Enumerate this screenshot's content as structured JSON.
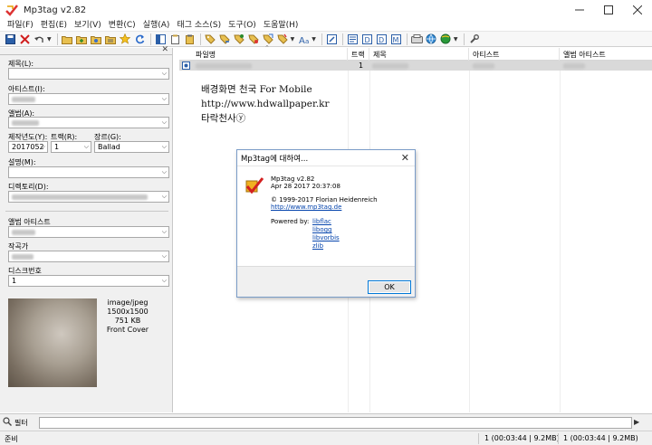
{
  "window": {
    "title": "Mp3tag v2.82"
  },
  "menu": [
    "파일(F)",
    "편집(E)",
    "보기(V)",
    "변환(C)",
    "실행(A)",
    "태그 소스(S)",
    "도구(O)",
    "도움말(H)"
  ],
  "tag_panel": {
    "title_label": "제목(L):",
    "artist_label": "아티스트(I):",
    "album_label": "앨범(A):",
    "year_label": "제작년도(Y):",
    "year_value": "2017052",
    "track_label": "트랙(R):",
    "track_value": "1",
    "genre_label": "장르(G):",
    "genre_value": "Ballad",
    "comment_label": "설명(M):",
    "directory_label": "디렉토리(D):",
    "album_artist_label": "앨범 아티스트",
    "composer_label": "작곡가",
    "disc_label": "디스크번호",
    "disc_value": "1",
    "cover": {
      "mime": "image/jpeg",
      "size": "1500x1500",
      "filesize": "751 KB",
      "type": "Front Cover"
    }
  },
  "file_list": {
    "columns": [
      "파일명",
      "트랙",
      "제목",
      "아티스트",
      "앨범 아티스트"
    ],
    "row": {
      "track": "1"
    }
  },
  "watermark": [
    "배경화면 천국 For Mobile",
    "http://www.hdwallpaper.kr",
    "타락천사ⓨ"
  ],
  "about_dialog": {
    "title": "Mp3tag에 대하여...",
    "app": "Mp3tag v2.82",
    "date": "Apr 28 2017 20:37:08",
    "copyright": "© 1999-2017 Florian Heidenreich",
    "url": "http://www.mp3tag.de",
    "powered_label": "Powered by:",
    "libs": [
      "libflac",
      "libogg",
      "libvorbis",
      "zlib"
    ],
    "ok": "OK"
  },
  "filter": {
    "label": "필터"
  },
  "status": {
    "left": "준비",
    "mid": "1 (00:03:44 | 9.2MB)",
    "right": "1 (00:03:44 | 9.2MB)"
  }
}
